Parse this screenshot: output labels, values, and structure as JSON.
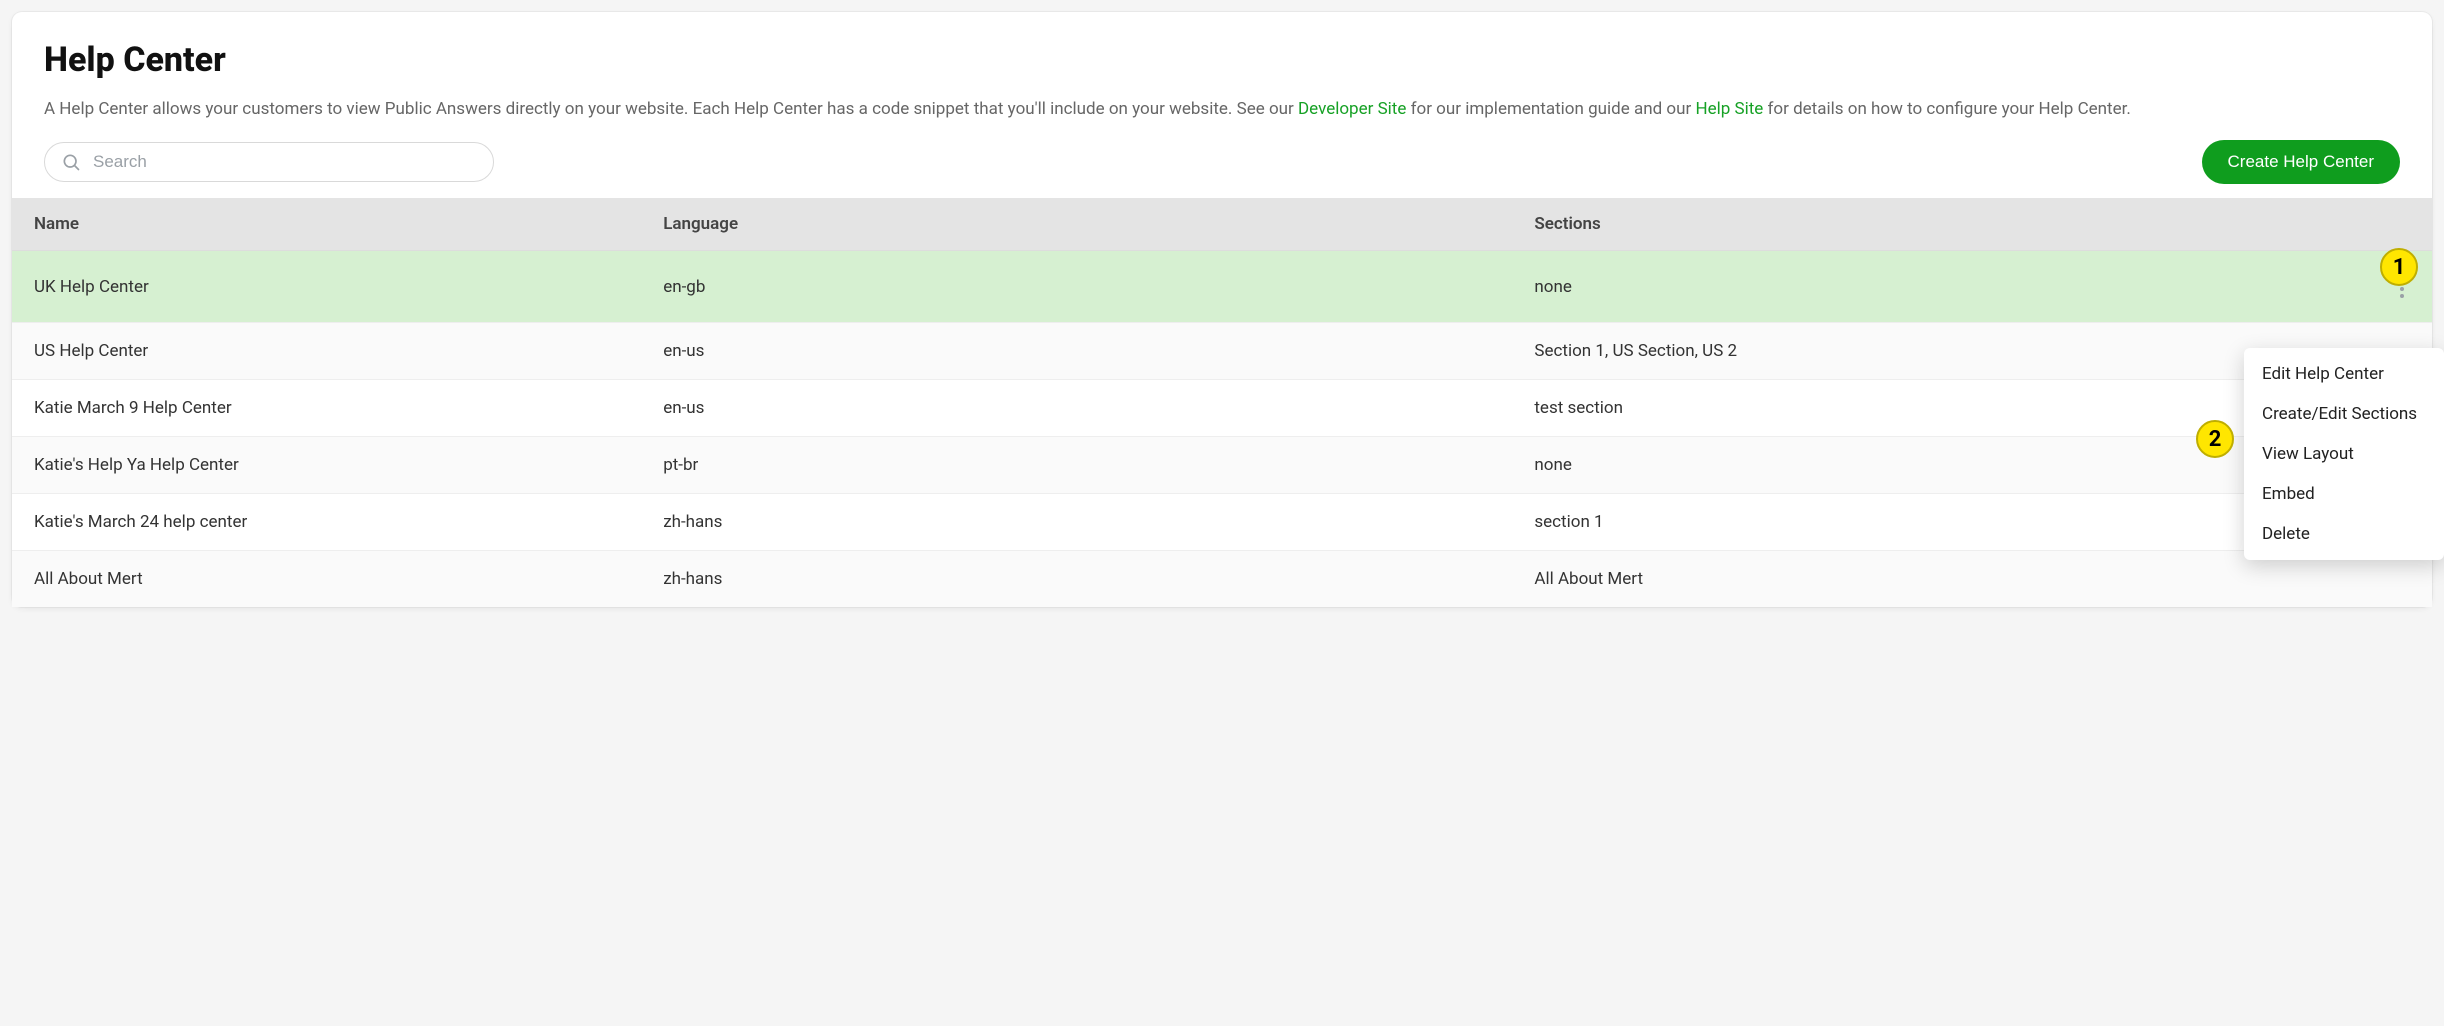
{
  "header": {
    "title": "Help Center",
    "description_parts": {
      "t1": "A Help Center allows your customers to view Public Answers directly on your website. Each Help Center has a code snippet that you'll include on your website. See our ",
      "link1": "Developer Site",
      "t2": " for our implementation guide and our ",
      "link2": "Help Site",
      "t3": " for details on how to configure your Help Center."
    }
  },
  "search": {
    "placeholder": "Search",
    "value": ""
  },
  "buttons": {
    "create": "Create Help Center"
  },
  "table": {
    "columns": {
      "name": "Name",
      "language": "Language",
      "sections": "Sections"
    },
    "rows": [
      {
        "name": "UK Help Center",
        "language": "en-gb",
        "sections": "none",
        "selected": true
      },
      {
        "name": "US Help Center",
        "language": "en-us",
        "sections": "Section 1, US Section, US 2",
        "selected": false
      },
      {
        "name": "Katie March 9 Help Center",
        "language": "en-us",
        "sections": "test section",
        "selected": false
      },
      {
        "name": "Katie's Help Ya Help Center",
        "language": "pt-br",
        "sections": "none",
        "selected": false
      },
      {
        "name": "Katie's March 24 help center",
        "language": "zh-hans",
        "sections": "section 1",
        "selected": false
      },
      {
        "name": "All About Mert",
        "language": "zh-hans",
        "sections": "All About Mert",
        "selected": false
      }
    ]
  },
  "context_menu": {
    "items": [
      "Edit Help Center",
      "Create/Edit Sections",
      "View Layout",
      "Embed",
      "Delete"
    ]
  },
  "callouts": {
    "one": "1",
    "two": "2"
  }
}
